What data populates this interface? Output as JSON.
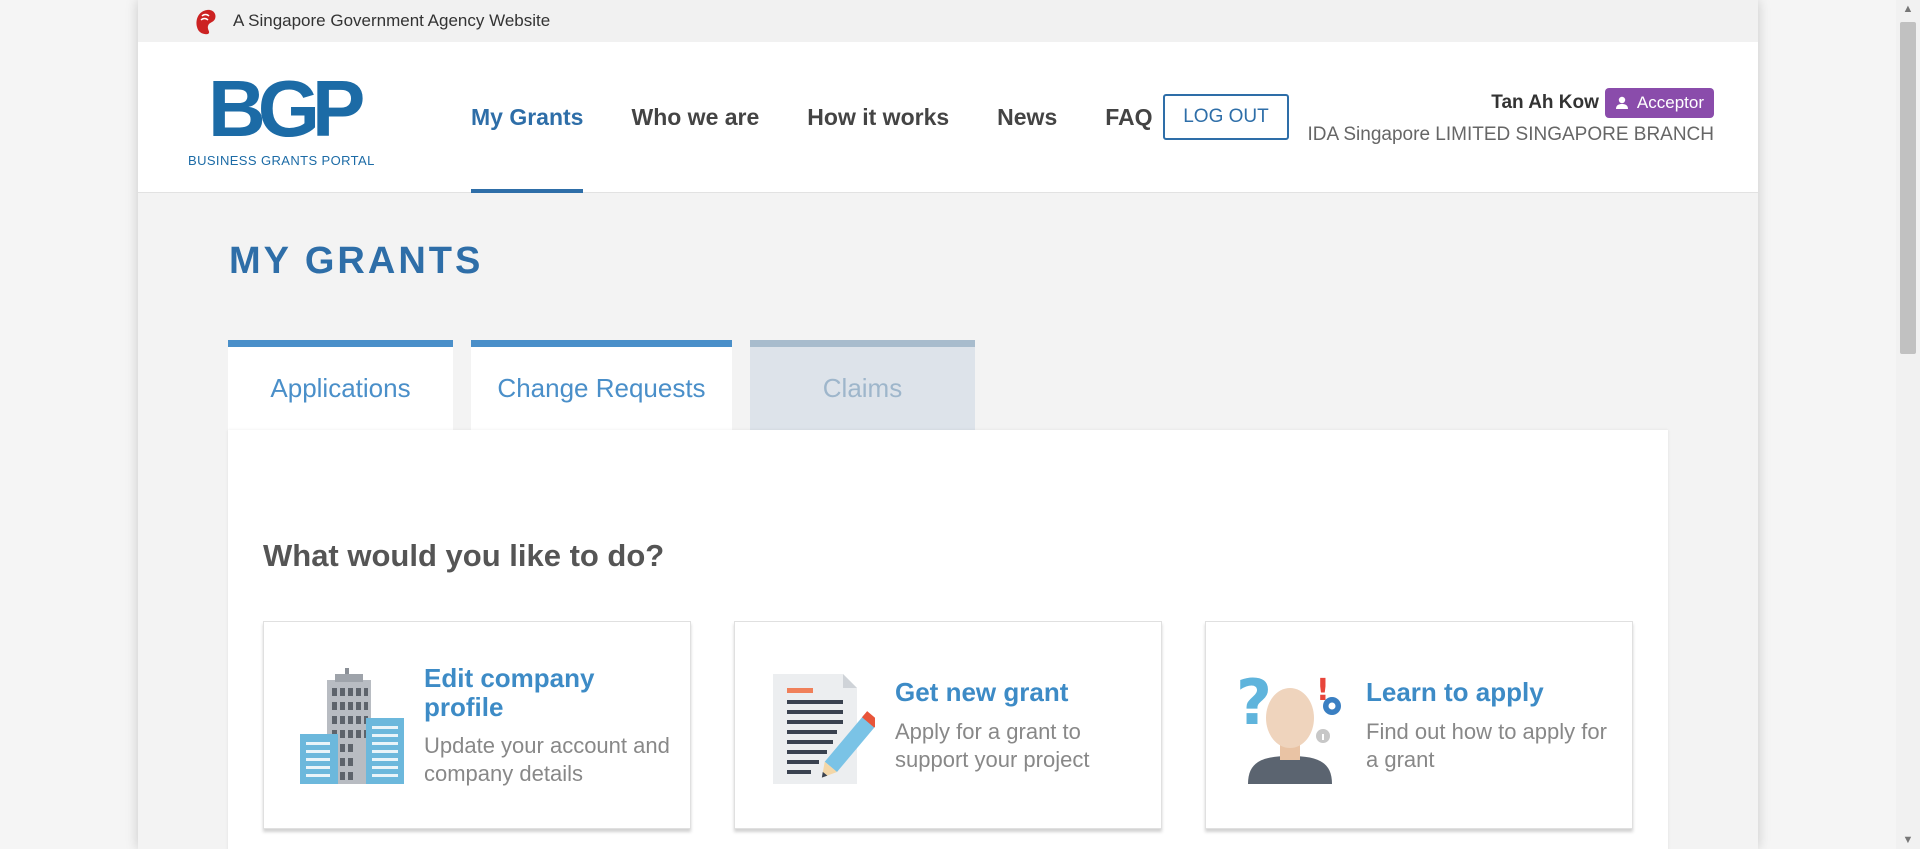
{
  "gov_bar": {
    "text": "A Singapore Government Agency Website"
  },
  "logo": {
    "mark": "BGP",
    "subtitle": "BUSINESS GRANTS PORTAL"
  },
  "nav": {
    "items": [
      {
        "label": "My Grants",
        "active": true
      },
      {
        "label": "Who we are"
      },
      {
        "label": "How it works"
      },
      {
        "label": "News"
      },
      {
        "label": "FAQ"
      }
    ],
    "logout_label": "LOG OUT"
  },
  "user": {
    "name": "Tan Ah Kow",
    "role": "Acceptor",
    "organization": "IDA Singapore LIMITED SINGAPORE BRANCH"
  },
  "page_title": "MY GRANTS",
  "tabs": [
    {
      "label": "Applications",
      "state": "active"
    },
    {
      "label": "Change Requests",
      "state": "active"
    },
    {
      "label": "Claims",
      "state": "disabled"
    }
  ],
  "panel": {
    "question": "What would you like to do?",
    "cards": [
      {
        "title": "Edit company profile",
        "description": "Update your account and company details",
        "icon": "building-icon"
      },
      {
        "title": "Get new grant",
        "description": "Apply for a grant to support your project",
        "icon": "document-pencil-icon"
      },
      {
        "title": "Learn to apply",
        "description": "Find out how to apply for a grant",
        "icon": "person-question-icon"
      }
    ]
  },
  "colors": {
    "primary": "#2e6ea8",
    "link": "#3d8bc6",
    "badge": "#8a4cab",
    "lion": "#cc2222"
  }
}
